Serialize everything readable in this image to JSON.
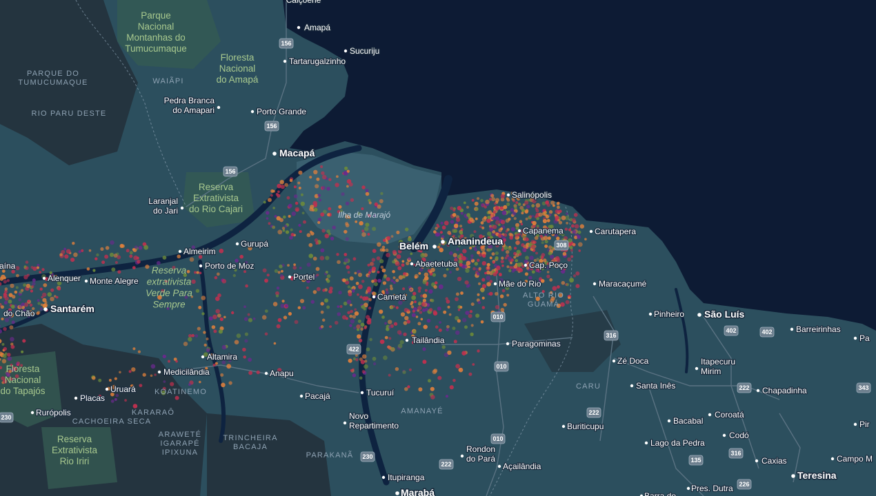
{
  "map": {
    "colors": {
      "ocean": "#0d1b34",
      "land": "#2c4f5e",
      "terrain": "#24343f",
      "river": "#0e2340",
      "park": "#355a52",
      "road": "#5b7383",
      "dot_orange": "#e0803c",
      "dot_red": "#c2304f",
      "dot_purple": "#6a2a8c",
      "dot_green": "#6c8a3a"
    },
    "cities": [
      {
        "name": "Calçoene"
      },
      {
        "name": "Amapá"
      },
      {
        "name": "Sucuriju"
      },
      {
        "name": "Tartarugalzinho"
      },
      {
        "name": "Porto Grande"
      },
      {
        "name": "Macapá"
      },
      {
        "name": "Salinópolis"
      },
      {
        "name": "Capanema"
      },
      {
        "name": "Carutapera"
      },
      {
        "name": "Belém"
      },
      {
        "name": "Ananindeua"
      },
      {
        "name": "Abaetetuba"
      },
      {
        "name": "Cap. Poço"
      },
      {
        "name": "Mãe do Rio"
      },
      {
        "name": "Maracaçumé"
      },
      {
        "name": "Cametá"
      },
      {
        "name": "Almeirim"
      },
      {
        "name": "Gurupá"
      },
      {
        "name": "Porto de Moz"
      },
      {
        "name": "Portel"
      },
      {
        "name": "Alenquer"
      },
      {
        "name": "Monte Alegre"
      },
      {
        "name": "Santarém"
      },
      {
        "name": "Pinheiro"
      },
      {
        "name": "São Luís"
      },
      {
        "name": "Barreirinhas"
      },
      {
        "name": "Paragominas"
      },
      {
        "name": "Tailândia"
      },
      {
        "name": "Zé Doca"
      },
      {
        "name": "Santa Inês"
      },
      {
        "name": "Chapadinha"
      },
      {
        "name": "Altamira"
      },
      {
        "name": "Medicilândia"
      },
      {
        "name": "Anapu"
      },
      {
        "name": "Uruará"
      },
      {
        "name": "Placas"
      },
      {
        "name": "Rurópolis"
      },
      {
        "name": "Pacajá"
      },
      {
        "name": "Tucuruí"
      },
      {
        "name": "Bacabal"
      },
      {
        "name": "Coroatá"
      },
      {
        "name": "Buriticupu"
      },
      {
        "name": "Lago da Pedra"
      },
      {
        "name": "Codó"
      },
      {
        "name": "Caxias"
      },
      {
        "name": "Campo M"
      },
      {
        "name": "Teresina"
      },
      {
        "name": "Açailândia"
      },
      {
        "name": "Itupiranga"
      },
      {
        "name": "Marabá"
      },
      {
        "name": "Pres. Dutra"
      },
      {
        "name": "Pa"
      },
      {
        "name": "Pir"
      },
      {
        "name": "Barra do"
      }
    ],
    "multiline_cities": [
      {
        "lines": [
          "Pedra Branca",
          "do Amapari"
        ]
      },
      {
        "lines": [
          "Laranjal",
          "do Jari"
        ]
      },
      {
        "lines": [
          "Novo",
          "Repartimento"
        ]
      },
      {
        "lines": [
          "Rondon",
          "do Pará"
        ]
      },
      {
        "lines": [
          "Itapecuru",
          "Mirim"
        ]
      }
    ],
    "partial_cities": [
      {
        "name": "aína"
      },
      {
        "name": "do Chão"
      }
    ],
    "parks": [
      {
        "lines": [
          "Parque",
          "Nacional",
          "Montanhas do",
          "Tumucumaque"
        ]
      },
      {
        "lines": [
          "Floresta",
          "Nacional",
          "do Amapá"
        ]
      },
      {
        "lines": [
          "Reserva",
          "Extrativista",
          "do Rio Cajari"
        ]
      },
      {
        "lines": [
          "Floresta",
          "Nacional",
          "do Tapajós"
        ]
      },
      {
        "lines": [
          "Reserva",
          "Extrativista",
          "Rio Iriri"
        ]
      }
    ],
    "italic_parks": [
      {
        "lines": [
          "Reserva",
          "extrativista",
          "Verde Para",
          "Sempre"
        ]
      }
    ],
    "regions": [
      {
        "lines": [
          "PARQUE DO",
          "TUMUCUMAQUE"
        ]
      },
      {
        "lines": [
          "WAIÃPI"
        ]
      },
      {
        "lines": [
          "RIO PARU DESTE"
        ]
      },
      {
        "lines": [
          "ALTO RIO",
          "GUAMÁ"
        ]
      },
      {
        "lines": [
          "KOATINEMO"
        ]
      },
      {
        "lines": [
          "CARU"
        ]
      },
      {
        "lines": [
          "AMANAYÉ"
        ]
      },
      {
        "lines": [
          "KARARAÔ"
        ]
      },
      {
        "lines": [
          "CACHOEIRA SECA"
        ]
      },
      {
        "lines": [
          "ARAWETÉ",
          "IGARAPÉ",
          "IPIXUNA"
        ]
      },
      {
        "lines": [
          "TRINCHEIRA",
          "BACAJA"
        ]
      },
      {
        "lines": [
          "PARAKANÃ"
        ]
      }
    ],
    "islands": [
      {
        "name": "Ilha de Marajó"
      }
    ],
    "road_shields": [
      "156",
      "156",
      "156",
      "308",
      "010",
      "010",
      "010",
      "422",
      "316",
      "316",
      "402",
      "402",
      "222",
      "222",
      "222",
      "230",
      "230",
      "343",
      "135",
      "226"
    ]
  }
}
